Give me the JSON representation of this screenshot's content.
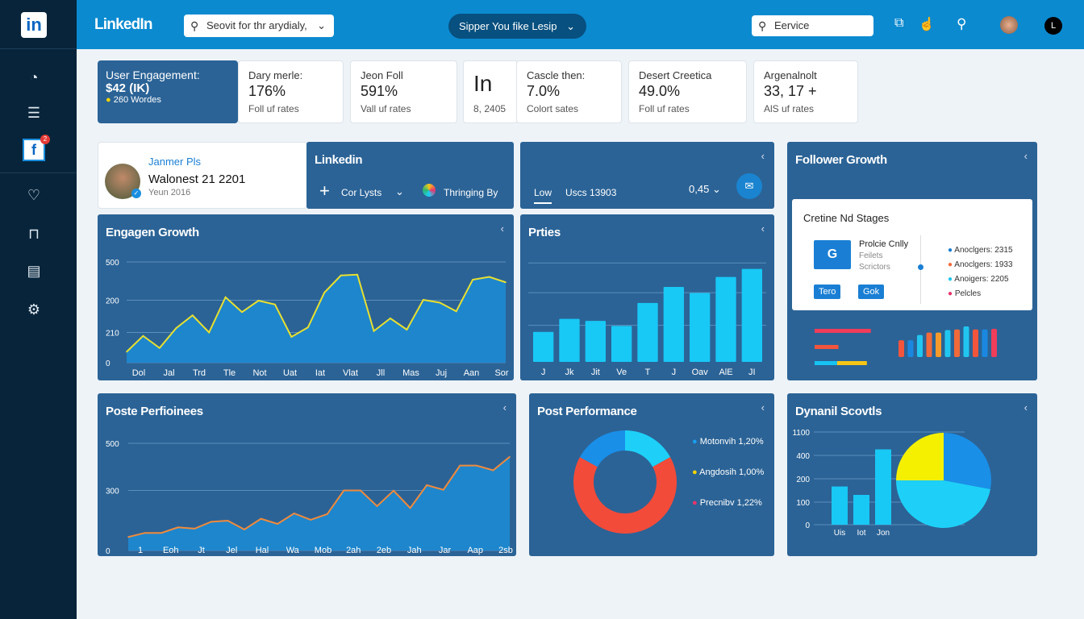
{
  "brand": {
    "logo": "in",
    "title": "LinkedIn"
  },
  "sidebar": {
    "items": [
      {
        "icon": "dashboard-gauge-icon"
      },
      {
        "icon": "list-icon"
      },
      {
        "icon": "facebook-icon",
        "badge": "2"
      },
      {
        "icon": "heart-icon"
      },
      {
        "icon": "book-icon"
      },
      {
        "icon": "document-icon"
      },
      {
        "icon": "settings-icon"
      }
    ]
  },
  "topbar": {
    "search_placeholder": "Seovit for thr arydialy,",
    "center_pill": "Sipper You fike Lesip",
    "right_search": "Eervice",
    "avatar_letter": "L"
  },
  "stats": [
    {
      "label": "User Engagement:",
      "value": "$42 (IK)",
      "sub": "260 Wordes"
    },
    {
      "label": "Dary merle:",
      "value": "176%",
      "sub": "Foll uf rates"
    },
    {
      "label": "Jeon Foll",
      "value": "591%",
      "sub": "Vall uf rates"
    },
    {
      "label": "",
      "value": "In",
      "sub": "8, 2405"
    },
    {
      "label": "Cascle then:",
      "value": "7.0%",
      "sub": "Colort sates"
    },
    {
      "label": "Desert Creetica",
      "value": "49.0%",
      "sub": "Foll uf rates"
    },
    {
      "label": "Argenalnolt",
      "value": "33, 17 +",
      "sub": "AlS uf rates"
    }
  ],
  "profile": {
    "name": "Janmer Pls",
    "headline": "Walonest 21 2201",
    "since": "Yeun 2016"
  },
  "linkedin_panel": {
    "title": "Linkedin",
    "add_label": "Cor Lysts",
    "trending": "Thringing By"
  },
  "filter_panel": {
    "tab_active": "Low",
    "tab_other": "Uscs 13903",
    "value": "0,45"
  },
  "follower": {
    "title": "Follower Growth",
    "card_title": "Cretine Nd Stages",
    "tile": "G",
    "profile_title": "Prolcie Cnlly",
    "profile_l1": "Feilets",
    "profile_l2": "Scrictors",
    "btn1": "Tero",
    "btn2": "Gok",
    "legend": [
      {
        "label": "Anoclgers: 2315",
        "color": "#1a7fd4"
      },
      {
        "label": "Anoclgers: 1933",
        "color": "#f26a3a"
      },
      {
        "label": "Anoigers: 2205",
        "color": "#21c6f0"
      },
      {
        "label": "Pelcles",
        "color": "#e8336b"
      }
    ],
    "hbars": [
      {
        "parts": [
          0.85
        ],
        "colors": [
          "#ef3d5a"
        ]
      },
      {
        "parts": [
          0.36
        ],
        "colors": [
          "#f2553c"
        ]
      },
      {
        "parts": [
          0.34,
          0.45
        ],
        "colors": [
          "#16c3f2",
          "#f5c518"
        ]
      }
    ],
    "vbars": [
      {
        "v": 0.55,
        "c": "#f2553c"
      },
      {
        "v": 0.55,
        "c": "#1a88e0"
      },
      {
        "v": 0.72,
        "c": "#21c6f0"
      },
      {
        "v": 0.8,
        "c": "#f26a3a"
      },
      {
        "v": 0.8,
        "c": "#f59a2a"
      },
      {
        "v": 0.88,
        "c": "#21c6f0"
      },
      {
        "v": 0.9,
        "c": "#f26a3a"
      },
      {
        "v": 1.0,
        "c": "#21c6f0"
      },
      {
        "v": 0.9,
        "c": "#f2553c"
      },
      {
        "v": 0.9,
        "c": "#1a88e0"
      },
      {
        "v": 0.92,
        "c": "#ef3d5a"
      }
    ]
  },
  "chart_data": [
    {
      "type": "area",
      "title": "Engagen Growth",
      "ylim": [
        0,
        500
      ],
      "yticks": [
        {
          "label": "0",
          "value": 0
        },
        {
          "label": "210",
          "value": 150
        },
        {
          "label": "200",
          "value": 310
        },
        {
          "label": "500",
          "value": 500
        }
      ],
      "xlabels": [
        "Dol",
        "Jal",
        "Trd",
        "Tle",
        "Not",
        "Uat",
        "Iat",
        "Vlat",
        "Jll",
        "Mas",
        "Juj",
        "Aan",
        "Sor"
      ],
      "values": [
        54,
        133,
        73,
        171,
        235,
        150,
        325,
        251,
        308,
        289,
        128,
        175,
        348,
        433,
        437,
        157,
        220,
        164,
        312,
        298,
        255,
        412,
        426,
        399
      ],
      "line_color": "#e8e030",
      "fill_color": "#1e86cc",
      "grid": true
    },
    {
      "type": "bar",
      "title": "Prties",
      "ylim": [
        0,
        100
      ],
      "categories": [
        "J",
        "Jk",
        "Jit",
        "Ve",
        "T",
        "J",
        "Oav",
        "AlE",
        "JI"
      ],
      "values": [
        30,
        43,
        41,
        36,
        59,
        75,
        69,
        85,
        93
      ],
      "color": "#18c8f5",
      "grid": true
    },
    {
      "type": "area",
      "title": "Poste Perfioinees",
      "ylim": [
        0,
        500
      ],
      "yticks": [
        {
          "label": "0",
          "value": 0
        },
        {
          "label": "300",
          "value": 280
        },
        {
          "label": "500",
          "value": 500
        }
      ],
      "xlabels": [
        "1",
        "Eoh",
        "Jt",
        "Jel",
        "Hal",
        "Wa",
        "Mob",
        "2ah",
        "2eb",
        "Jah",
        "Jar",
        "Aap",
        "2sb"
      ],
      "values": [
        63,
        82,
        82,
        108,
        102,
        134,
        139,
        98,
        148,
        124,
        173,
        143,
        170,
        280,
        280,
        207,
        279,
        198,
        305,
        283,
        396,
        396,
        374,
        437
      ],
      "line_color": "#f08a3c",
      "fill_color": "#1e86cc",
      "grid": true
    },
    {
      "type": "pie",
      "title": "Post Performance",
      "donut": true,
      "slices": [
        {
          "value": 17,
          "color": "#1ed0f8"
        },
        {
          "value": 66,
          "color": "#f24b3a"
        },
        {
          "value": 17,
          "color": "#1a8fe8"
        }
      ],
      "legend": [
        {
          "label": "Motonvih 1,20%",
          "color": "#1a9ff0"
        },
        {
          "label": "Angdosih 1,00%",
          "color": "#f5d400"
        },
        {
          "label": "Precnibv 1,22%",
          "color": "#e8336b"
        }
      ]
    },
    {
      "type": "bar",
      "title": "Dynanil Scovtls",
      "yticks": [
        {
          "label": "0",
          "value": 0
        },
        {
          "label": "100",
          "value": 100
        },
        {
          "label": "200",
          "value": 200
        },
        {
          "label": "400",
          "value": 400
        },
        {
          "label": "1100",
          "value": 1100
        }
      ],
      "categories": [
        "Uis",
        "Iot",
        "Jon"
      ],
      "values": [
        167,
        131,
        580
      ],
      "color": "#18c8f5",
      "pie": [
        {
          "value": 28,
          "color": "#1a8fe8"
        },
        {
          "value": 47,
          "color": "#1ed0f8"
        },
        {
          "value": 25,
          "color": "#f5f000"
        }
      ]
    }
  ]
}
